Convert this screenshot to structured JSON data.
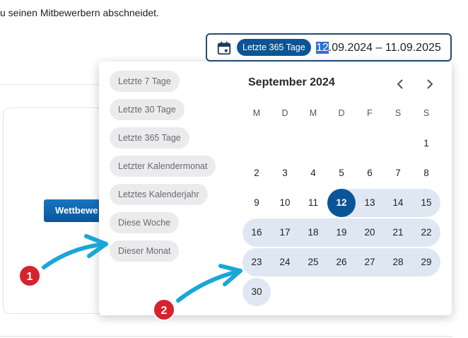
{
  "intro_text": "u seinen Mitbewerbern abschneidet.",
  "date_field": {
    "icon": "calendar-icon",
    "preset_chip": "Letzte 365 Tage",
    "range_selected_part": "12",
    "range_rest": ".09.2024 – 11.09.2025"
  },
  "background": {
    "competitor_button": "Wettbewe"
  },
  "presets": [
    "Letzte 7 Tage",
    "Letzte 30 Tage",
    "Letzte 365 Tage",
    "Letzter Kalendermonat",
    "Letztes Kalenderjahr",
    "Diese Woche",
    "Dieser Monat"
  ],
  "calendar": {
    "month_title": "September 2024",
    "weekdays": [
      "M",
      "D",
      "M",
      "D",
      "F",
      "S",
      "S"
    ],
    "first_weekday_index": 6,
    "days_in_month": 30,
    "selected_day": 12,
    "range_start_day": 12
  },
  "annotations": [
    "1",
    "2"
  ],
  "colors": {
    "accent": "#0b5596",
    "range_fill": "#dfe8f2",
    "chip_bg": "#ebebed",
    "badge": "#d8222e",
    "arrow": "#1aa7d8"
  }
}
